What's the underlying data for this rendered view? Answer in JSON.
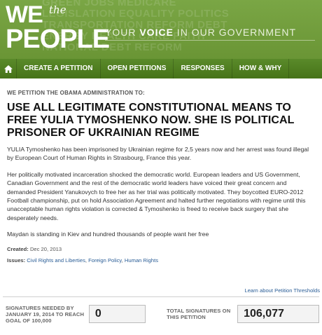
{
  "header": {
    "logo_we": "WE",
    "logo_the": "the",
    "logo_people": "PEOPLE",
    "tagline_your": "YOUR ",
    "tagline_voice": "VOICE",
    "tagline_rest": " IN OUR GOVERNMENT",
    "background_words": [
      "GREEN JOBS  MEDICARE",
      "LEGISLATION  EQUALITY  POLITICS",
      "TRANSPORTATION  REFORM  DEBT",
      "ENERGY  HEALTH CARE  FAITH",
      "NATIONAL DEBT  REFORM"
    ]
  },
  "nav": {
    "home_icon": "home-icon",
    "items": [
      "CREATE A PETITION",
      "OPEN PETITIONS",
      "RESPONSES",
      "HOW & WHY"
    ]
  },
  "petition": {
    "preheading": "WE PETITION THE OBAMA ADMINISTRATION TO:",
    "title": "USE ALL LEGITIMATE CONSTITUTIONAL MEANS TO FREE YULIA TYMOSHENKO NOW. SHE IS POLITICAL PRISONER OF UKRAINIAN REGIME",
    "paragraphs": [
      "YULIA Tymoshenko has been imprisoned by Ukrainian regime for 2,5 years now and her arrest was found illegal by European Court of Human Rights in Strasbourg, France this year.",
      "Her politically motivated incarceration shocked the democratic world. European leaders and US Government, Canadian Government and the rest of the democratic world leaders have voiced their great concern and demanded President Yanukovych to free her as her trial was politically motivated. They boycotted EURO-2012 Football championship, put on hold Association Agreement and halted further negotiations with regime until this unacceptable human rights violation is corrected & Tymoshenko is freed to receive back surgery that she desperately needs.",
      "Maydan is standing in Kiev and hundred thousands of people want her free"
    ],
    "created_label": "Created:",
    "created_date": "Dec 20, 2013",
    "issues_label": "Issues:",
    "issues": [
      "Civil Rights and Liberties",
      "Foreign Policy",
      "Human Rights"
    ],
    "learn_link": "Learn about Petition Thresholds"
  },
  "signatures": {
    "needed_label": "SIGNATURES NEEDED BY JANUARY 19, 2014 TO REACH GOAL OF 100,000",
    "needed_value": "0",
    "total_label": "TOTAL SIGNATURES ON THIS PETITION",
    "total_value": "106,077"
  },
  "colors": {
    "banner_green": "#6f9a3a",
    "nav_green": "#4f7d22",
    "link_blue": "#2a5d96"
  }
}
